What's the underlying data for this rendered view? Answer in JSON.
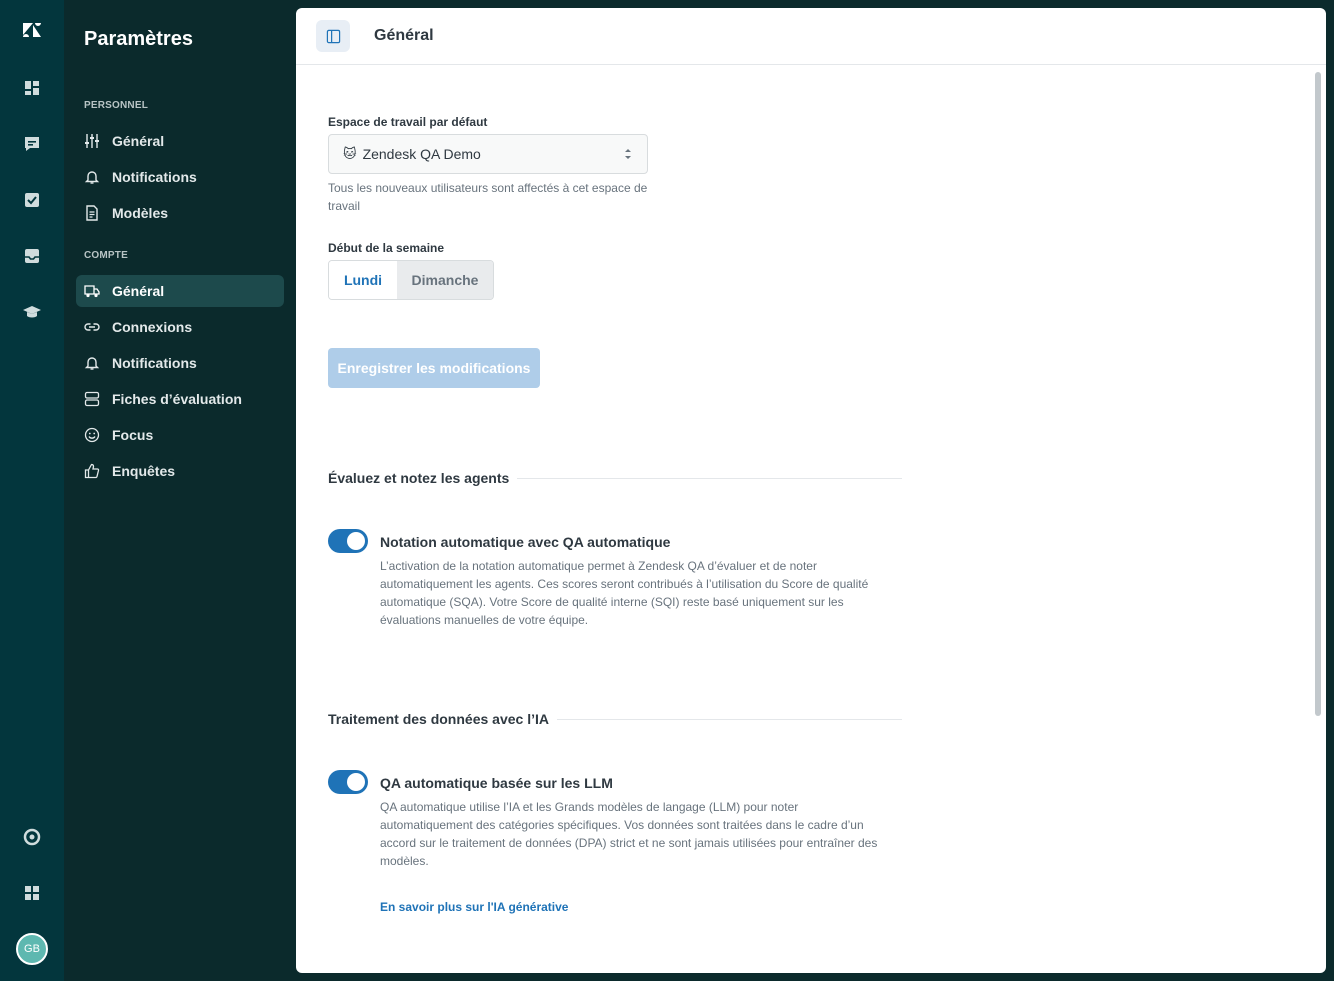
{
  "rail": {
    "items": [
      {
        "name": "zendesk-logo-icon"
      },
      {
        "name": "dashboard-icon"
      },
      {
        "name": "conversations-icon"
      },
      {
        "name": "tasks-icon"
      },
      {
        "name": "inbox-icon"
      },
      {
        "name": "coaching-icon"
      },
      {
        "name": "help-icon"
      },
      {
        "name": "apps-grid-icon"
      }
    ],
    "avatar_initials": "GB"
  },
  "nav": {
    "title": "Paramètres",
    "personal_label": "PERSONNEL",
    "personal_items": [
      {
        "label": "Général",
        "icon": "sliders-icon"
      },
      {
        "label": "Notifications",
        "icon": "bell-icon"
      },
      {
        "label": "Modèles",
        "icon": "document-icon"
      }
    ],
    "account_label": "COMPTE",
    "account_items": [
      {
        "label": "Général",
        "icon": "truck-icon",
        "active": true
      },
      {
        "label": "Connexions",
        "icon": "link-icon"
      },
      {
        "label": "Notifications",
        "icon": "bell-icon"
      },
      {
        "label": "Fiches d’évaluation",
        "icon": "scorecard-icon"
      },
      {
        "label": "Focus",
        "icon": "smiley-icon"
      },
      {
        "label": "Enquêtes",
        "icon": "thumbs-up-icon"
      }
    ]
  },
  "header": {
    "title": "Général"
  },
  "workspace": {
    "label": "Espace de travail par défaut",
    "value": "Zendesk QA Demo",
    "emoji": "🐱",
    "hint": "Tous les nouveaux utilisateurs sont affectés à cet espace de travail"
  },
  "week_start": {
    "label": "Début de la semaine",
    "options": [
      "Lundi",
      "Dimanche"
    ],
    "selected": "Lundi"
  },
  "save_button": "Enregistrer les modifications",
  "section_agents": {
    "heading": "Évaluez et notez les agents",
    "option_title": "Notation automatique avec QA automatique",
    "option_desc": "L’activation de la notation automatique permet à Zendesk QA d’évaluer et de noter automatiquement les agents. Ces scores seront contribués à l’utilisation du Score de qualité automatique (SQA). Votre Score de qualité interne (SQI) reste basé uniquement sur les évaluations manuelles de votre équipe.",
    "enabled": true
  },
  "section_ai": {
    "heading": "Traitement des données avec l’IA",
    "option_title": "QA automatique basée sur les LLM",
    "option_desc": "QA automatique utilise l’IA et les Grands modèles de langage (LLM) pour noter automatiquement des catégories spécifiques. Vos données sont traitées dans le cadre d’un accord sur le traitement de données (DPA) strict et ne sont jamais utilisées pour entraîner des modèles.",
    "link": "En savoir plus sur l'IA générative",
    "enabled": true
  },
  "colors": {
    "rail_bg": "#03363d",
    "nav_bg": "#0b2a2c",
    "accent": "#1f73b7",
    "save_disabled": "#afcde9"
  }
}
